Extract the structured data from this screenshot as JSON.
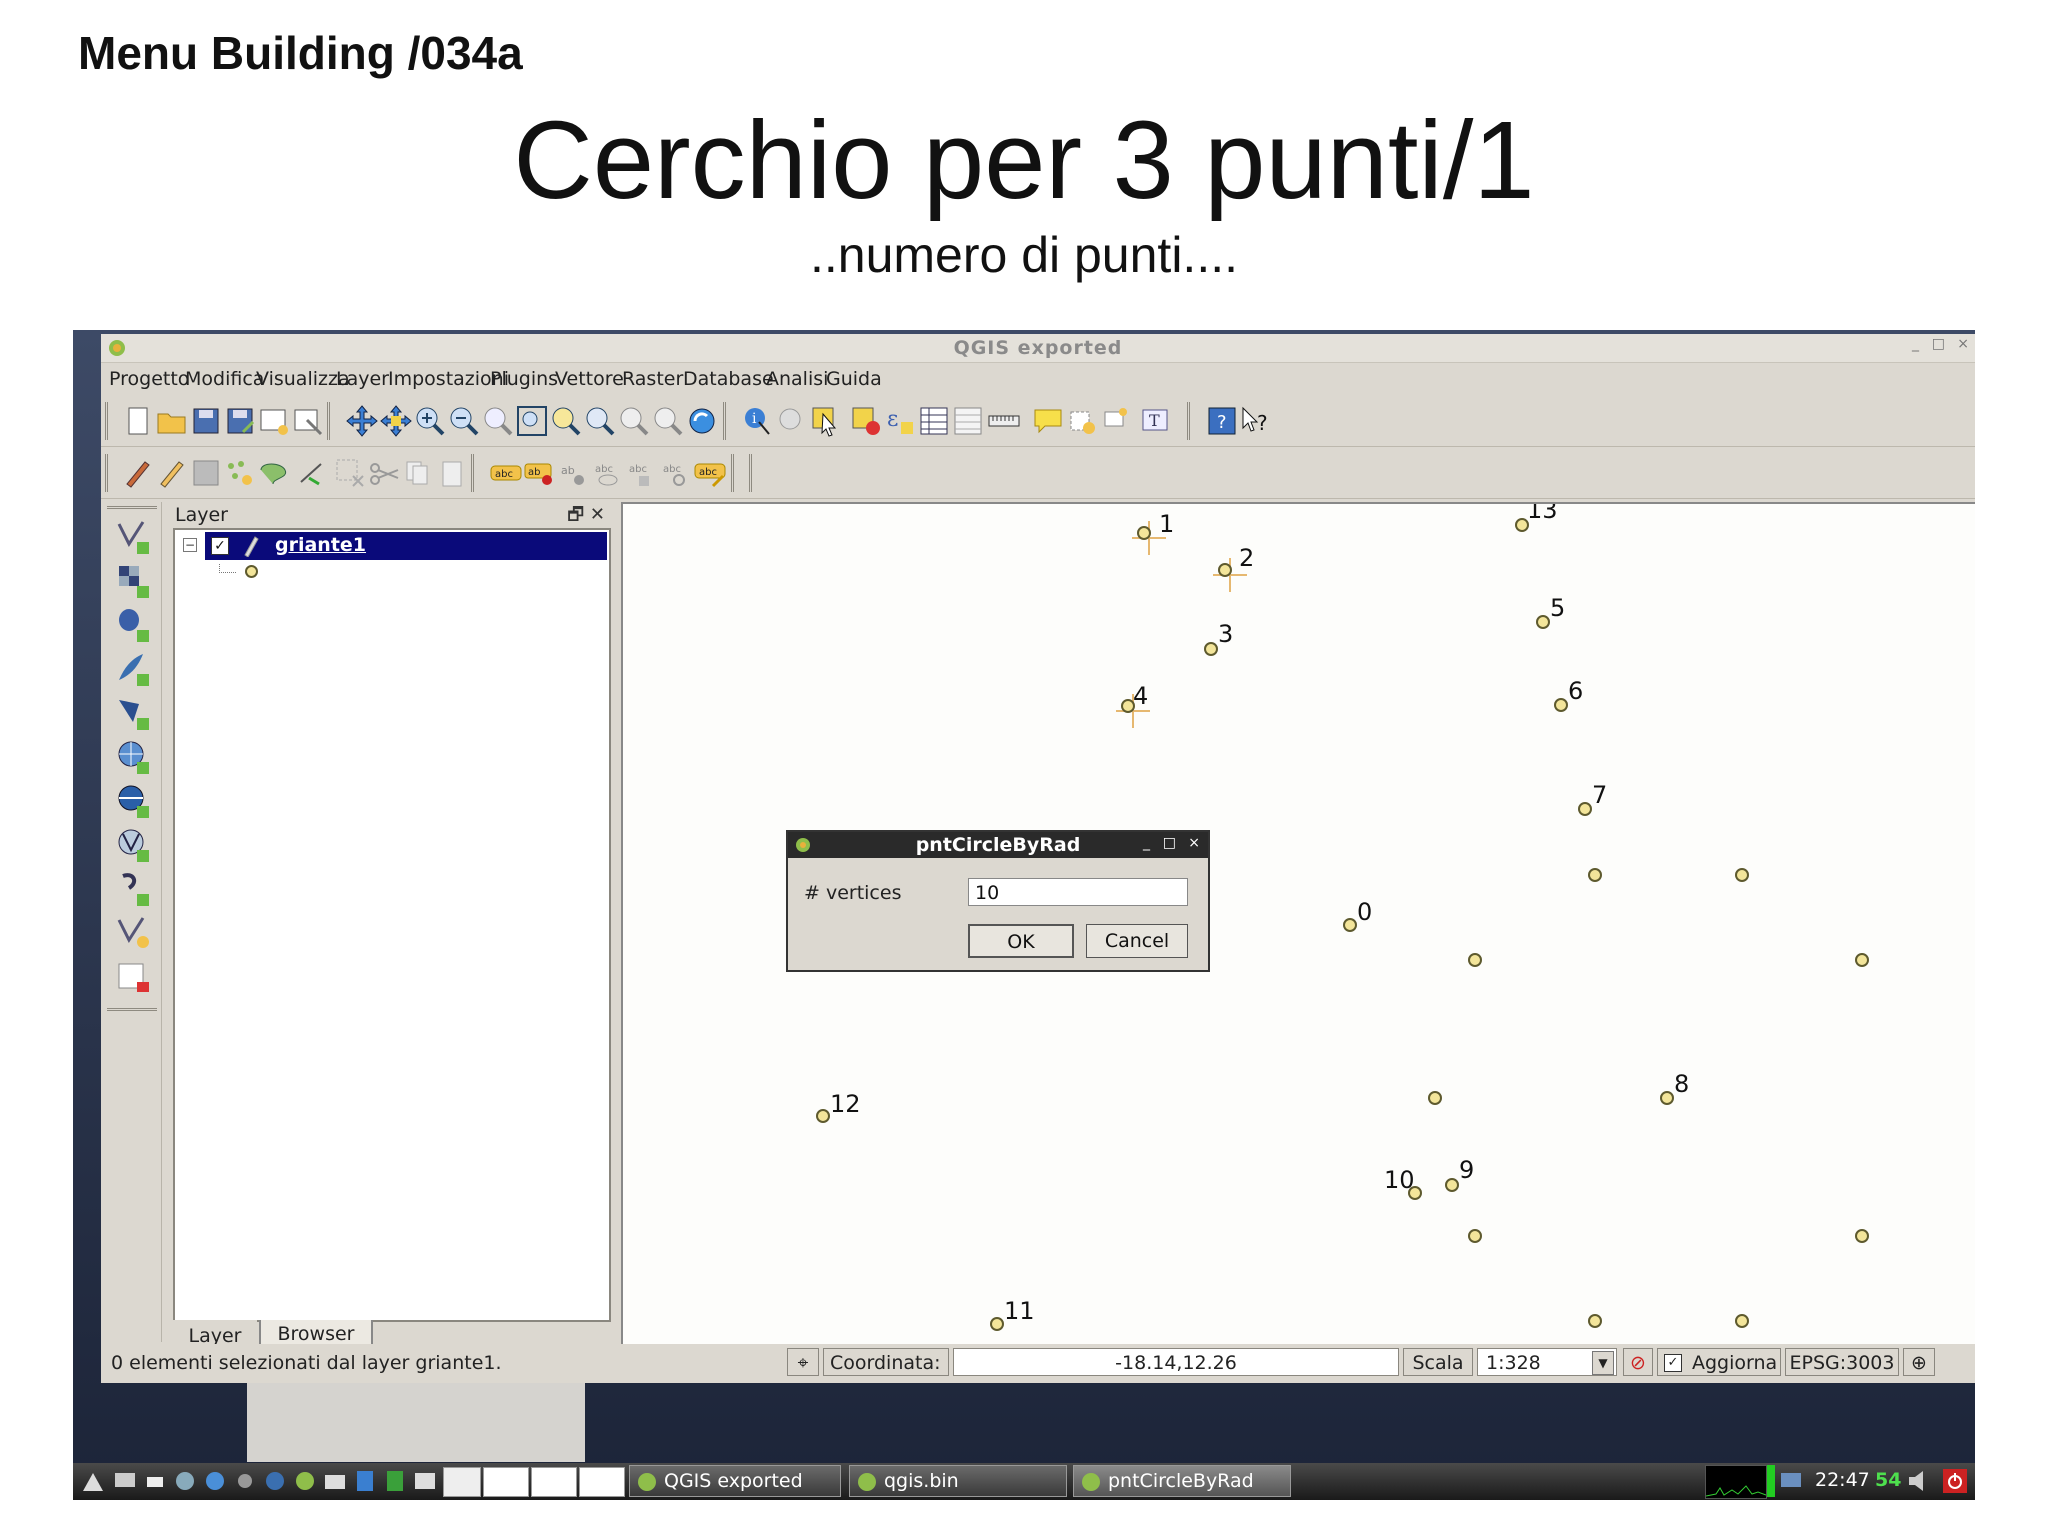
{
  "slide": {
    "header": "Menu Building /034a",
    "title": "Cerchio per 3 punti/1",
    "subtitle": "..numero di punti...."
  },
  "window": {
    "title": "QGIS exported",
    "controls": [
      "_",
      "□",
      "×"
    ]
  },
  "menubar": {
    "items": [
      "Progetto",
      "Modifica",
      "Visualizza",
      "Layer",
      "Impostazioni",
      "Plugins",
      "Vettore",
      "Raster",
      "Database",
      "Analisi",
      "Guida"
    ]
  },
  "layer_panel": {
    "title": "Layer",
    "layer_name": "griante1",
    "tabs": [
      "Layer",
      "Browser"
    ]
  },
  "map": {
    "point_labels": [
      "1",
      "2",
      "3",
      "4",
      "5",
      "6",
      "7",
      "8",
      "0",
      "12",
      "10",
      "9",
      "11",
      "13"
    ]
  },
  "dialog": {
    "title": "pntCircleByRad",
    "field_label": "# vertices",
    "field_value": "10",
    "ok_label": "OK",
    "cancel_label": "Cancel"
  },
  "statusbar": {
    "message": "0 elementi selezionati dal layer griante1.",
    "coord_label": "Coordinata:",
    "coord_value": "-18.14,12.26",
    "scale_label": "Scala",
    "scale_value": "1:328",
    "refresh_label": "Aggiorna",
    "crs": "EPSG:3003"
  },
  "taskbar": {
    "tasks": [
      "QGIS exported",
      "qgis.bin",
      "pntCircleByRad"
    ],
    "clock": "22:47",
    "clock_seconds": "54"
  },
  "colors": {
    "selection": "#0a0a7a",
    "point_fill": "#f3e59a",
    "dialog_title": "#2a2a2a",
    "clock_seconds": "#4ee04e"
  }
}
